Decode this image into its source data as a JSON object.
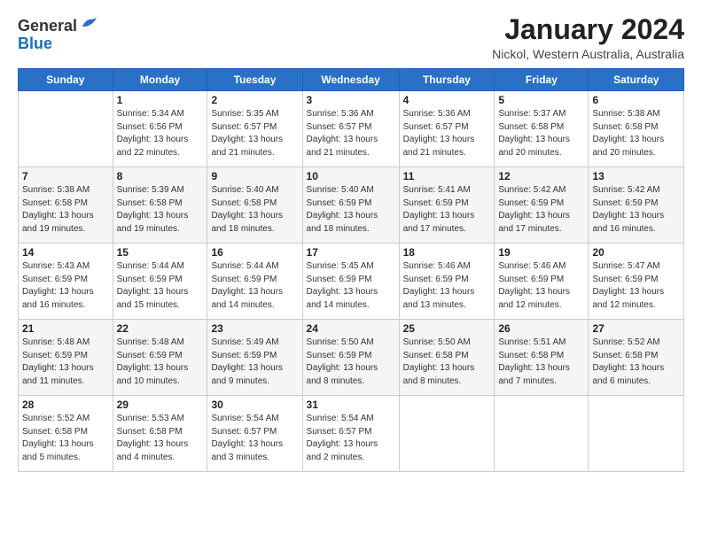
{
  "header": {
    "logo_general": "General",
    "logo_blue": "Blue",
    "month": "January 2024",
    "location": "Nickol, Western Australia, Australia"
  },
  "days_of_week": [
    "Sunday",
    "Monday",
    "Tuesday",
    "Wednesday",
    "Thursday",
    "Friday",
    "Saturday"
  ],
  "weeks": [
    [
      {
        "day": "",
        "info": ""
      },
      {
        "day": "1",
        "info": "Sunrise: 5:34 AM\nSunset: 6:56 PM\nDaylight: 13 hours\nand 22 minutes."
      },
      {
        "day": "2",
        "info": "Sunrise: 5:35 AM\nSunset: 6:57 PM\nDaylight: 13 hours\nand 21 minutes."
      },
      {
        "day": "3",
        "info": "Sunrise: 5:36 AM\nSunset: 6:57 PM\nDaylight: 13 hours\nand 21 minutes."
      },
      {
        "day": "4",
        "info": "Sunrise: 5:36 AM\nSunset: 6:57 PM\nDaylight: 13 hours\nand 21 minutes."
      },
      {
        "day": "5",
        "info": "Sunrise: 5:37 AM\nSunset: 6:58 PM\nDaylight: 13 hours\nand 20 minutes."
      },
      {
        "day": "6",
        "info": "Sunrise: 5:38 AM\nSunset: 6:58 PM\nDaylight: 13 hours\nand 20 minutes."
      }
    ],
    [
      {
        "day": "7",
        "info": "Sunrise: 5:38 AM\nSunset: 6:58 PM\nDaylight: 13 hours\nand 19 minutes."
      },
      {
        "day": "8",
        "info": "Sunrise: 5:39 AM\nSunset: 6:58 PM\nDaylight: 13 hours\nand 19 minutes."
      },
      {
        "day": "9",
        "info": "Sunrise: 5:40 AM\nSunset: 6:58 PM\nDaylight: 13 hours\nand 18 minutes."
      },
      {
        "day": "10",
        "info": "Sunrise: 5:40 AM\nSunset: 6:59 PM\nDaylight: 13 hours\nand 18 minutes."
      },
      {
        "day": "11",
        "info": "Sunrise: 5:41 AM\nSunset: 6:59 PM\nDaylight: 13 hours\nand 17 minutes."
      },
      {
        "day": "12",
        "info": "Sunrise: 5:42 AM\nSunset: 6:59 PM\nDaylight: 13 hours\nand 17 minutes."
      },
      {
        "day": "13",
        "info": "Sunrise: 5:42 AM\nSunset: 6:59 PM\nDaylight: 13 hours\nand 16 minutes."
      }
    ],
    [
      {
        "day": "14",
        "info": "Sunrise: 5:43 AM\nSunset: 6:59 PM\nDaylight: 13 hours\nand 16 minutes."
      },
      {
        "day": "15",
        "info": "Sunrise: 5:44 AM\nSunset: 6:59 PM\nDaylight: 13 hours\nand 15 minutes."
      },
      {
        "day": "16",
        "info": "Sunrise: 5:44 AM\nSunset: 6:59 PM\nDaylight: 13 hours\nand 14 minutes."
      },
      {
        "day": "17",
        "info": "Sunrise: 5:45 AM\nSunset: 6:59 PM\nDaylight: 13 hours\nand 14 minutes."
      },
      {
        "day": "18",
        "info": "Sunrise: 5:46 AM\nSunset: 6:59 PM\nDaylight: 13 hours\nand 13 minutes."
      },
      {
        "day": "19",
        "info": "Sunrise: 5:46 AM\nSunset: 6:59 PM\nDaylight: 13 hours\nand 12 minutes."
      },
      {
        "day": "20",
        "info": "Sunrise: 5:47 AM\nSunset: 6:59 PM\nDaylight: 13 hours\nand 12 minutes."
      }
    ],
    [
      {
        "day": "21",
        "info": "Sunrise: 5:48 AM\nSunset: 6:59 PM\nDaylight: 13 hours\nand 11 minutes."
      },
      {
        "day": "22",
        "info": "Sunrise: 5:48 AM\nSunset: 6:59 PM\nDaylight: 13 hours\nand 10 minutes."
      },
      {
        "day": "23",
        "info": "Sunrise: 5:49 AM\nSunset: 6:59 PM\nDaylight: 13 hours\nand 9 minutes."
      },
      {
        "day": "24",
        "info": "Sunrise: 5:50 AM\nSunset: 6:59 PM\nDaylight: 13 hours\nand 8 minutes."
      },
      {
        "day": "25",
        "info": "Sunrise: 5:50 AM\nSunset: 6:58 PM\nDaylight: 13 hours\nand 8 minutes."
      },
      {
        "day": "26",
        "info": "Sunrise: 5:51 AM\nSunset: 6:58 PM\nDaylight: 13 hours\nand 7 minutes."
      },
      {
        "day": "27",
        "info": "Sunrise: 5:52 AM\nSunset: 6:58 PM\nDaylight: 13 hours\nand 6 minutes."
      }
    ],
    [
      {
        "day": "28",
        "info": "Sunrise: 5:52 AM\nSunset: 6:58 PM\nDaylight: 13 hours\nand 5 minutes."
      },
      {
        "day": "29",
        "info": "Sunrise: 5:53 AM\nSunset: 6:58 PM\nDaylight: 13 hours\nand 4 minutes."
      },
      {
        "day": "30",
        "info": "Sunrise: 5:54 AM\nSunset: 6:57 PM\nDaylight: 13 hours\nand 3 minutes."
      },
      {
        "day": "31",
        "info": "Sunrise: 5:54 AM\nSunset: 6:57 PM\nDaylight: 13 hours\nand 2 minutes."
      },
      {
        "day": "",
        "info": ""
      },
      {
        "day": "",
        "info": ""
      },
      {
        "day": "",
        "info": ""
      }
    ]
  ]
}
